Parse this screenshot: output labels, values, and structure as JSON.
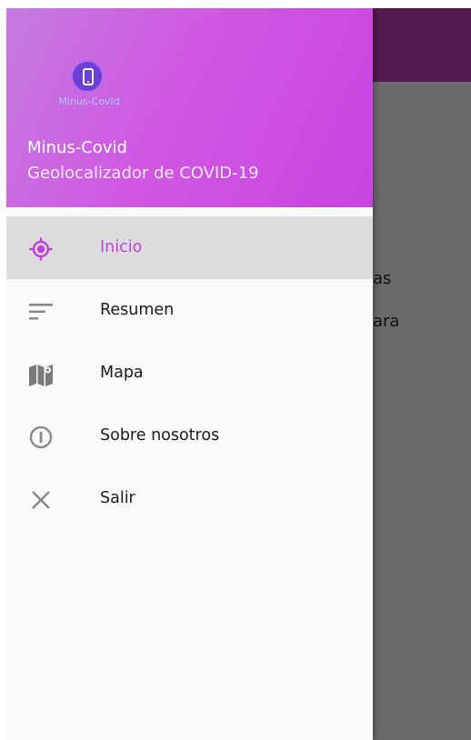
{
  "app": {
    "title": "Minus-Covid",
    "subtitle": "Geolocalizador de COVID-19",
    "logo_text": "Minus-Covid",
    "accent_color": "#c23fda"
  },
  "background": {
    "partial_text": [
      "as",
      "ara"
    ]
  },
  "menu": {
    "items": [
      {
        "label": "Inicio",
        "icon": "crosshair-icon",
        "selected": true
      },
      {
        "label": "Resumen",
        "icon": "sort-lines-icon",
        "selected": false
      },
      {
        "label": "Mapa",
        "icon": "map-icon",
        "selected": false
      },
      {
        "label": "Sobre nosotros",
        "icon": "info-icon",
        "selected": false
      },
      {
        "label": "Salir",
        "icon": "close-icon",
        "selected": false
      }
    ]
  }
}
